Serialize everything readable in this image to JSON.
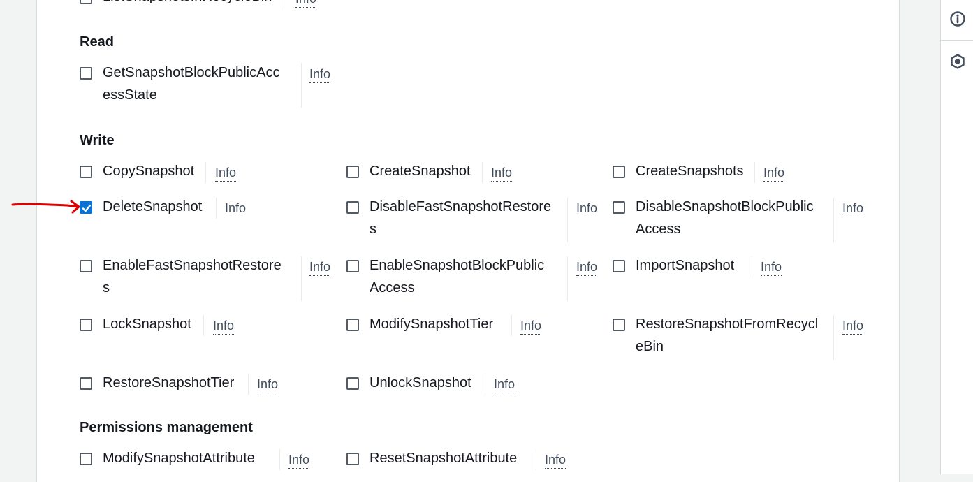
{
  "top_cut_item": {
    "label": "ListSnapshotsInRecycleBin",
    "info": "Info"
  },
  "groups": {
    "read": {
      "title": "Read"
    },
    "write": {
      "title": "Write"
    },
    "permissions": {
      "title": "Permissions management"
    }
  },
  "read_actions": [
    {
      "label": "GetSnapshotBlockPublicAcc\nessState",
      "info": "Info",
      "checked": false
    }
  ],
  "write_actions": [
    {
      "label": "CopySnapshot",
      "info": "Info",
      "checked": false
    },
    {
      "label": "CreateSnapshot",
      "info": "Info",
      "checked": false
    },
    {
      "label": "CreateSnapshots",
      "info": "Info",
      "checked": false
    },
    {
      "label": "DeleteSnapshot",
      "info": "Info",
      "checked": true
    },
    {
      "label": "DisableFastSnapshotRestore\ns",
      "info": "Info",
      "checked": false
    },
    {
      "label": "DisableSnapshotBlockPublic\nAccess",
      "info": "Info",
      "checked": false
    },
    {
      "label": "EnableFastSnapshotRestore\ns",
      "info": "Info",
      "checked": false
    },
    {
      "label": "EnableSnapshotBlockPublic\nAccess",
      "info": "Info",
      "checked": false
    },
    {
      "label": "ImportSnapshot",
      "info": "Info",
      "checked": false
    },
    {
      "label": "LockSnapshot",
      "info": "Info",
      "checked": false
    },
    {
      "label": "ModifySnapshotTier",
      "info": "Info",
      "checked": false
    },
    {
      "label": "RestoreSnapshotFromRecycl\neBin",
      "info": "Info",
      "checked": false
    },
    {
      "label": "RestoreSnapshotTier",
      "info": "Info",
      "checked": false
    },
    {
      "label": "UnlockSnapshot",
      "info": "Info",
      "checked": false
    }
  ],
  "permissions_actions": [
    {
      "label": "ModifySnapshotAttribute",
      "info": "Info",
      "checked": false
    },
    {
      "label": "ResetSnapshotAttribute",
      "info": "Info",
      "checked": false
    }
  ],
  "colors": {
    "accent": "#0972d3",
    "annotation": "#e00000"
  },
  "rail_icons": [
    "info-icon",
    "hexagon-icon"
  ]
}
